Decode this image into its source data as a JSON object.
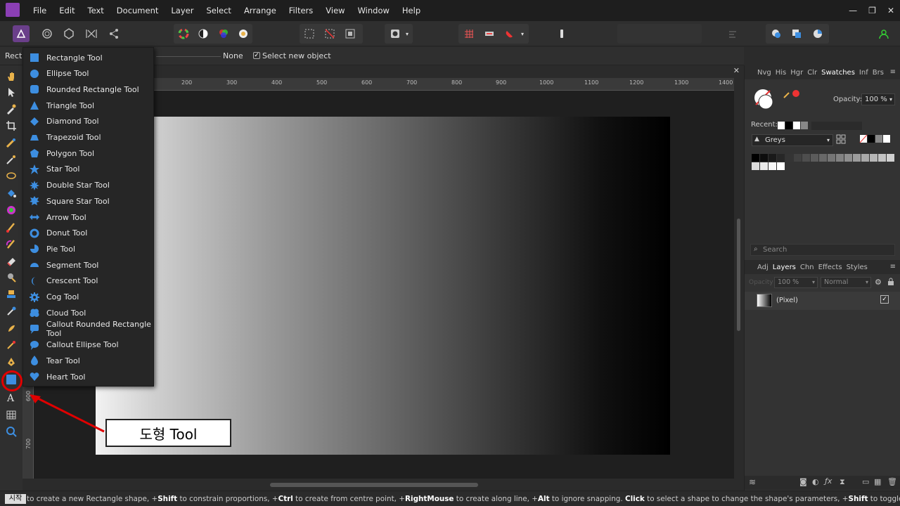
{
  "menubar": {
    "items": [
      "File",
      "Edit",
      "Text",
      "Document",
      "Layer",
      "Select",
      "Arrange",
      "Filters",
      "View",
      "Window",
      "Help"
    ],
    "window_controls": [
      "—",
      "❐",
      "✕"
    ]
  },
  "context_bar": {
    "tool_label": "Rect",
    "stroke_value": "None",
    "select_new_object_label": "Select new object",
    "select_new_object_checked": true
  },
  "document": {
    "close_label": "✕"
  },
  "ruler": {
    "h_ticks": [
      "200",
      "300",
      "400",
      "500",
      "600",
      "700",
      "800",
      "900",
      "1000",
      "1100",
      "1200",
      "1300",
      "1400"
    ],
    "v_ticks": [
      "600",
      "700"
    ]
  },
  "flyout": {
    "items": [
      {
        "label": "Rectangle Tool",
        "icon": "rectangle-icon"
      },
      {
        "label": "Ellipse Tool",
        "icon": "ellipse-icon"
      },
      {
        "label": "Rounded Rectangle Tool",
        "icon": "rounded-rectangle-icon"
      },
      {
        "label": "Triangle Tool",
        "icon": "triangle-icon"
      },
      {
        "label": "Diamond Tool",
        "icon": "diamond-icon"
      },
      {
        "label": "Trapezoid Tool",
        "icon": "trapezoid-icon"
      },
      {
        "label": "Polygon Tool",
        "icon": "polygon-icon"
      },
      {
        "label": "Star Tool",
        "icon": "star-icon"
      },
      {
        "label": "Double Star Tool",
        "icon": "double-star-icon"
      },
      {
        "label": "Square Star Tool",
        "icon": "square-star-icon"
      },
      {
        "label": "Arrow Tool",
        "icon": "arrow-icon"
      },
      {
        "label": "Donut Tool",
        "icon": "donut-icon"
      },
      {
        "label": "Pie Tool",
        "icon": "pie-icon"
      },
      {
        "label": "Segment Tool",
        "icon": "segment-icon"
      },
      {
        "label": "Crescent Tool",
        "icon": "crescent-icon"
      },
      {
        "label": "Cog Tool",
        "icon": "cog-icon"
      },
      {
        "label": "Cloud Tool",
        "icon": "cloud-icon"
      },
      {
        "label": "Callout Rounded Rectangle Tool",
        "icon": "callout-rounded-rectangle-icon"
      },
      {
        "label": "Callout Ellipse Tool",
        "icon": "callout-ellipse-icon"
      },
      {
        "label": "Tear Tool",
        "icon": "tear-icon"
      },
      {
        "label": "Heart Tool",
        "icon": "heart-icon"
      }
    ]
  },
  "swatches_panel": {
    "tabs": [
      "Nvg",
      "His",
      "Hgr",
      "Clr",
      "Swatches",
      "Inf",
      "Brs"
    ],
    "active_tab": "Swatches",
    "opacity_label": "Opacity:",
    "opacity_value": "100 %",
    "recent_label": "Recent:",
    "palette_name": "Greys",
    "search_placeholder": "Search"
  },
  "layers_panel": {
    "tabs": [
      "Adj",
      "Layers",
      "Chn",
      "Effects",
      "Styles"
    ],
    "active_tab": "Layers",
    "opacity_label": "Opacity",
    "opacity_value": "100 %",
    "blend_mode": "Normal",
    "layers": [
      {
        "name": "(Pixel)",
        "visible": true
      }
    ]
  },
  "statusbar": {
    "start_chip": "시작",
    "hint_parts": [
      {
        "t": "to create a new Rectangle shape, +",
        "b": false
      },
      {
        "t": "Shift",
        "b": true
      },
      {
        "t": " to constrain proportions, +",
        "b": false
      },
      {
        "t": "Ctrl",
        "b": true
      },
      {
        "t": " to create from centre point, +",
        "b": false
      },
      {
        "t": "RightMouse",
        "b": true
      },
      {
        "t": " to create along line, +",
        "b": false
      },
      {
        "t": "Alt",
        "b": true
      },
      {
        "t": " to ignore snapping. ",
        "b": false
      },
      {
        "t": "Click",
        "b": true
      },
      {
        "t": " to select a shape to change the shape's parameters, +",
        "b": false
      },
      {
        "t": "Shift",
        "b": true
      },
      {
        "t": " to toggle select.",
        "b": false
      }
    ]
  },
  "annotation": {
    "label": "도형 Tool"
  },
  "colors": {
    "accent": "#3d8ee0",
    "annotation_red": "#e00000",
    "brand": "#8b3fb5"
  }
}
